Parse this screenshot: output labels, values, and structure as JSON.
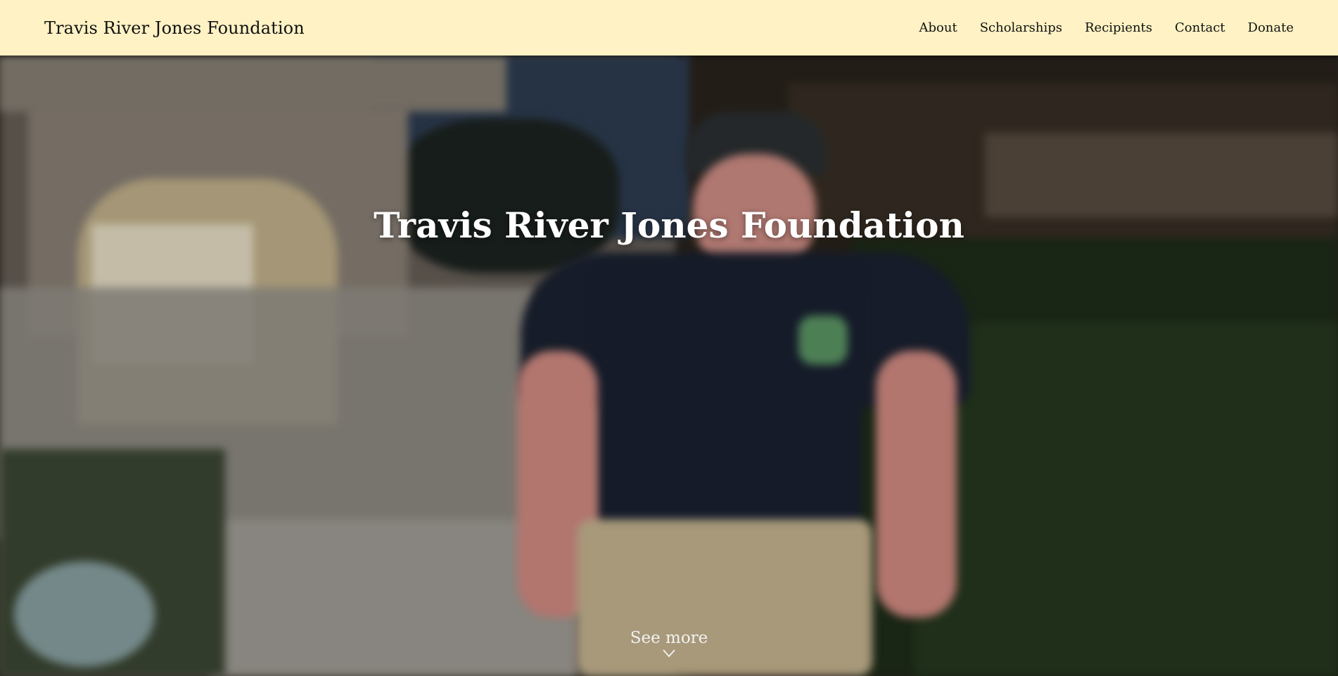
{
  "header": {
    "brand": "Travis River Jones Foundation",
    "nav": [
      "About",
      "Scholarships",
      "Recipients",
      "Contact",
      "Donate"
    ]
  },
  "hero": {
    "title": "Travis River Jones Foundation",
    "see_more": "See more",
    "see_more_icon": "chevron-down-icon"
  },
  "colors": {
    "header_bg": "#fff2c4",
    "hero_text": "#ffffff"
  }
}
